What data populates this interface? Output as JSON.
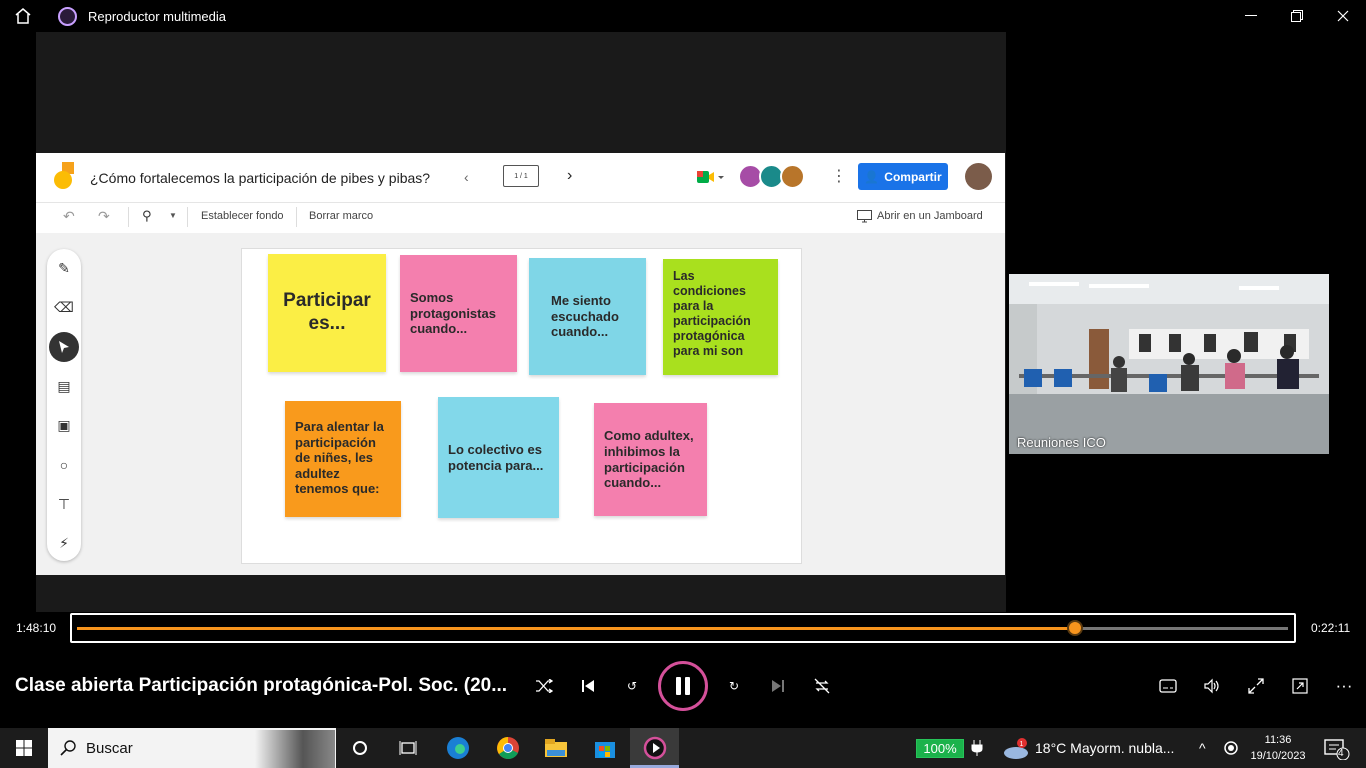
{
  "titlebar": {
    "title": "Reproductor multimedia"
  },
  "jamboard": {
    "title": "¿Cómo fortalecemos la participación de pibes y pibas?",
    "frame_indicator": "1 / 1",
    "share_label": "Compartir",
    "toolbar": {
      "set_background": "Establecer fondo",
      "clear_frame": "Borrar marco",
      "open_in_jamboard": "Abrir en un Jamboard"
    }
  },
  "stickies": [
    {
      "text": "Participar es...",
      "color": "#fbee45"
    },
    {
      "text": "Somos protagonistas cuando...",
      "color": "#f47fae"
    },
    {
      "text": "Me siento escuchado cuando...",
      "color": "#7fd6e7"
    },
    {
      "text": "Las condiciones para la participación protagónica para mi son",
      "color": "#a9e01e"
    },
    {
      "text": "Para alentar la participación de niñes, les adultez tenemos que:",
      "color": "#f99a1c"
    },
    {
      "text": "Lo colectivo es potencia para...",
      "color": "#82d8ea"
    },
    {
      "text": "Como adultex, inhibimos la participación cuando...",
      "color": "#f47fae"
    }
  ],
  "webcam": {
    "label": "Reuniones ICO"
  },
  "player": {
    "elapsed": "1:48:10",
    "remaining": "0:22:11",
    "progress_fraction": 0.824,
    "media_title": "Clase abierta Participación protagónica-Pol. Soc. (20...",
    "accent": "#f7941d"
  },
  "taskbar": {
    "search_placeholder": "Buscar",
    "battery": "100%",
    "weather": "18°C  Mayorm. nubla...",
    "time": "11:36",
    "date": "19/10/2023",
    "notif_count": "4"
  }
}
